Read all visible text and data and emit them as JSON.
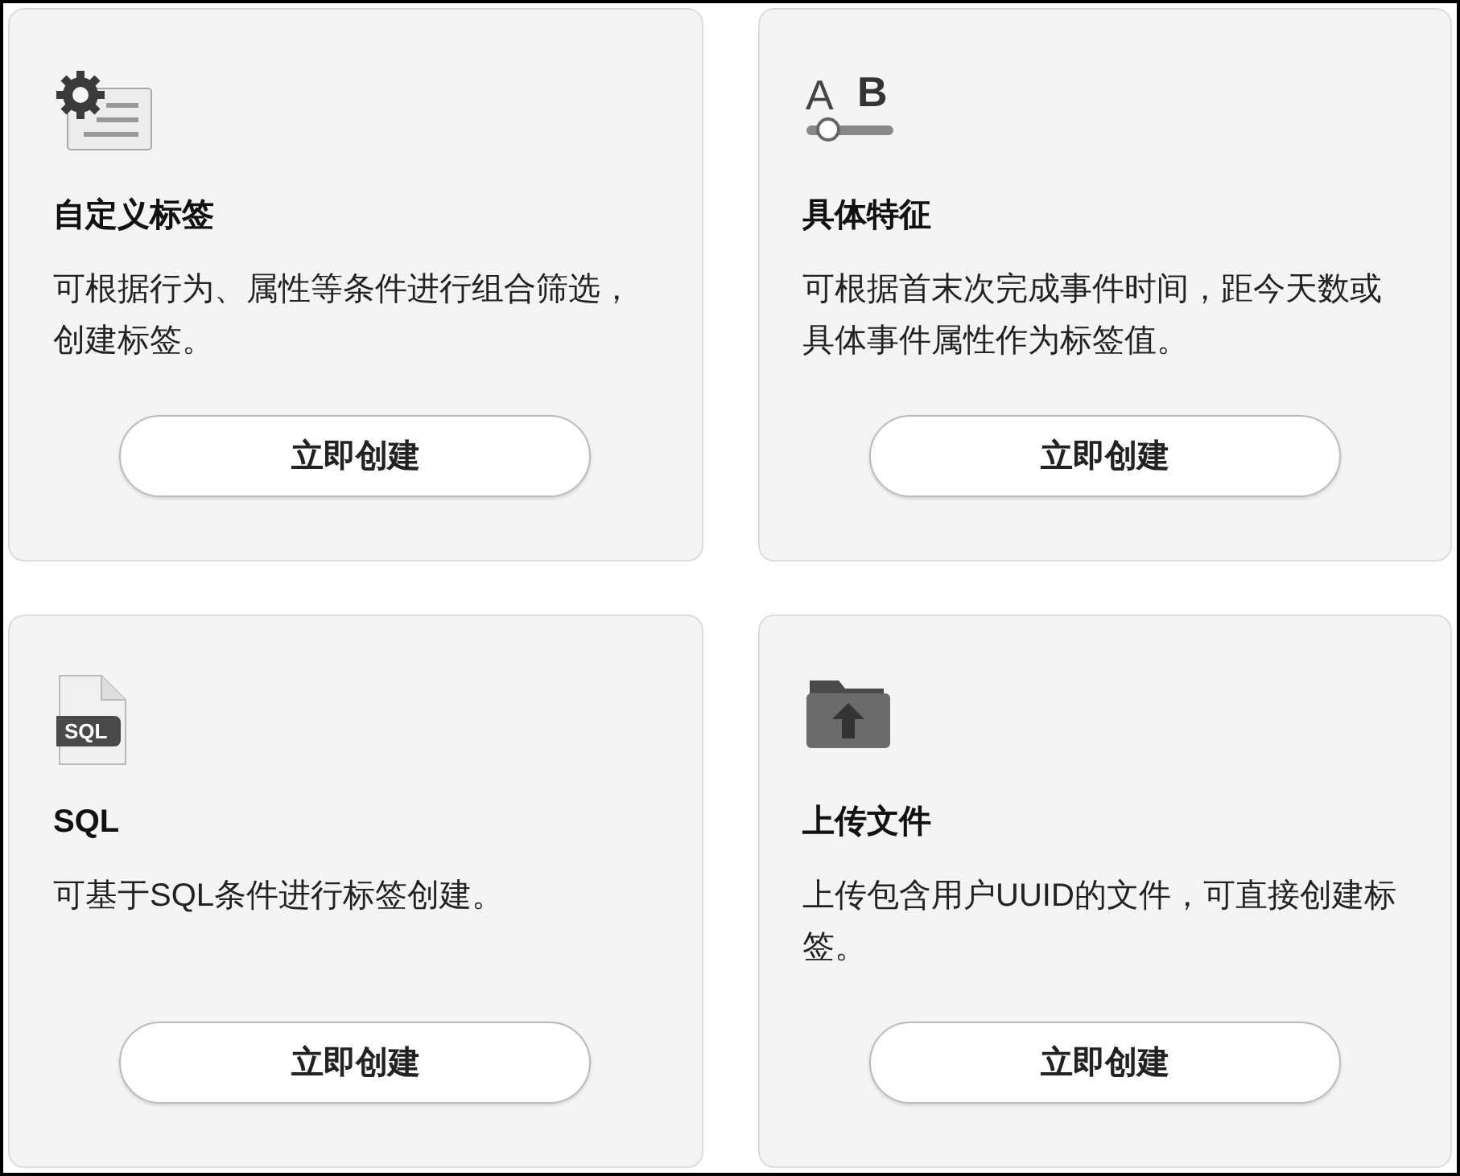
{
  "cards": [
    {
      "kind": "settings",
      "title": "自定义标签",
      "description": "可根据行为、属性等条件进行组合筛选，创建标签。",
      "button": "立即创建"
    },
    {
      "kind": "font-size",
      "icon_text": [
        "A",
        "B"
      ],
      "title": "具体特征",
      "description": "可根据首末次完成事件时间，距今天数或具体事件属性作为标签值。",
      "button": "立即创建"
    },
    {
      "kind": "file",
      "icon_text": [
        "SQL"
      ],
      "title": "SQL",
      "description": "可基于SQL条件进行标签创建。",
      "button": "立即创建"
    },
    {
      "kind": "upload",
      "title": "上传文件",
      "description": "上传包含用户UUID的文件，可直接创建标签。",
      "button": "立即创建"
    }
  ]
}
